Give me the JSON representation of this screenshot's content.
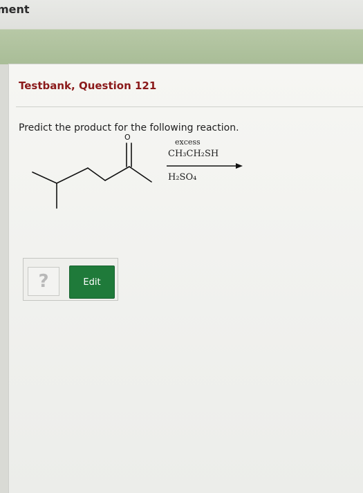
{
  "header": {
    "title": "ment"
  },
  "question": {
    "title": "Testbank, Question 121",
    "prompt": "Predict the product for the following reaction.",
    "molecule": {
      "carbonyl_label": "O"
    },
    "reagents": {
      "above_1": "excess",
      "above_2": "CH₃CH₂SH",
      "below": "H₂SO₄"
    }
  },
  "answer": {
    "placeholder": "?",
    "edit_label": "Edit"
  },
  "colors": {
    "title_red": "#8b1a1a",
    "edit_green": "#1f7a3a",
    "band_green": "#aebf9b"
  }
}
